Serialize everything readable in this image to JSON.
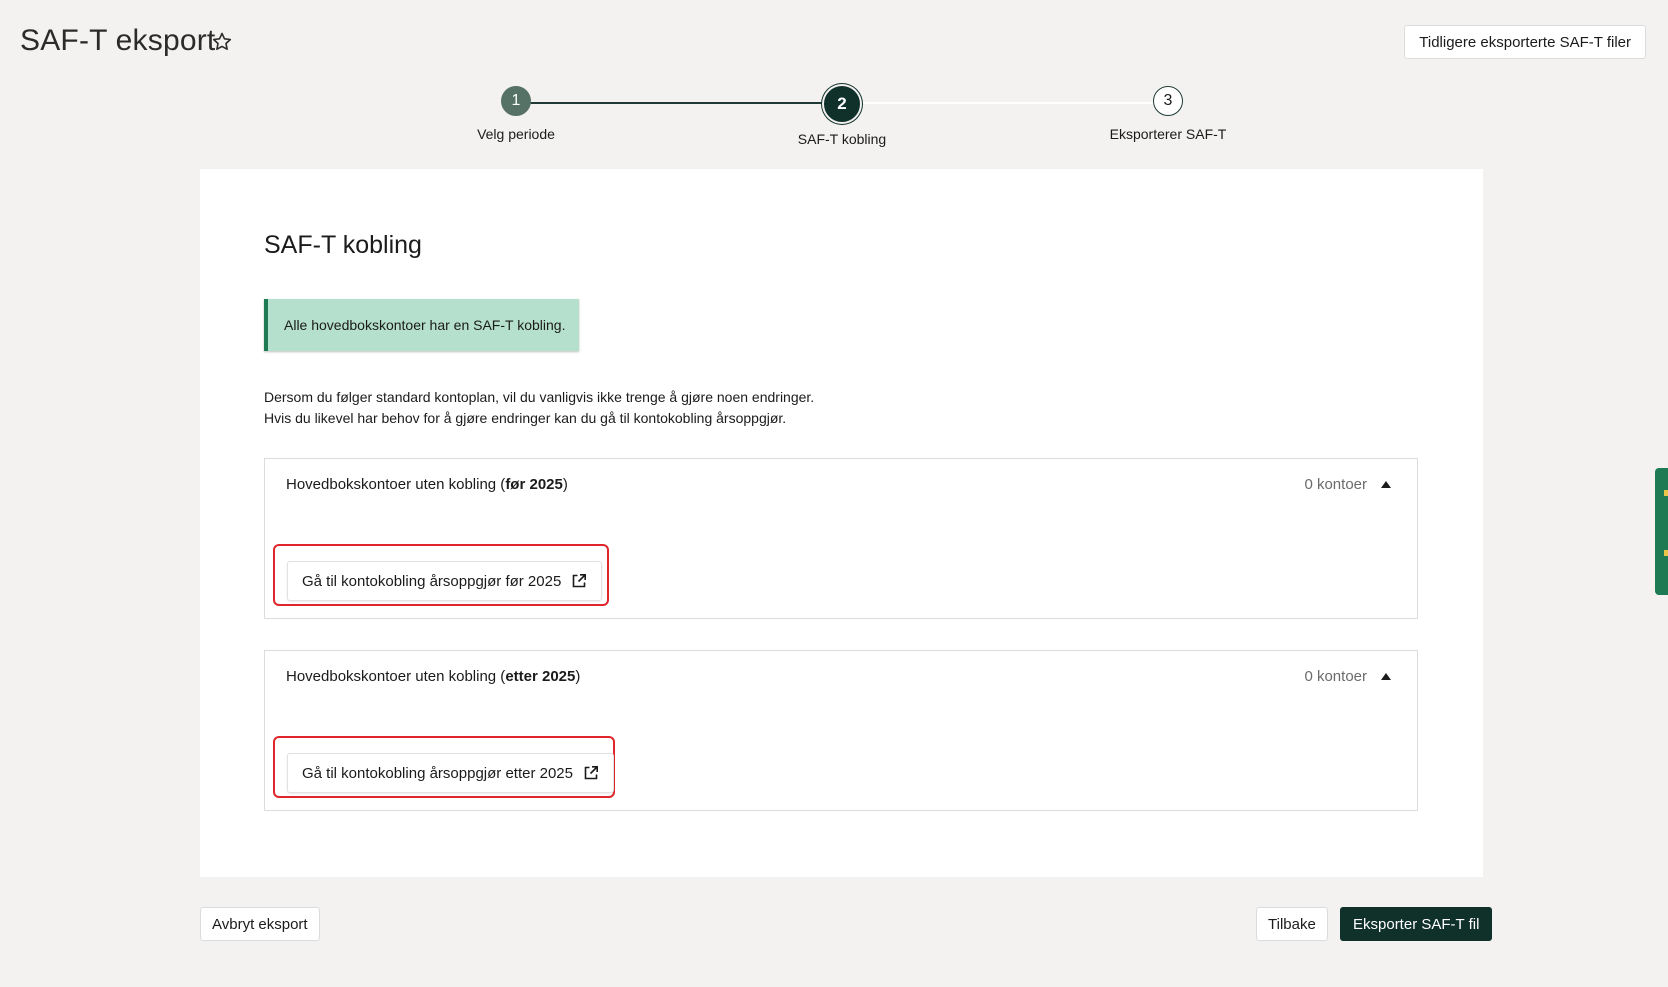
{
  "header": {
    "title": "SAF-T eksport",
    "favorite_icon": "star-outline-icon",
    "prev_files_label": "Tidligere eksporterte SAF-T filer"
  },
  "stepper": {
    "current_step": 2,
    "total_steps": 3,
    "steps": [
      {
        "number": "1",
        "label": "Velg periode",
        "state": "completed"
      },
      {
        "number": "2",
        "label": "SAF-T kobling",
        "state": "current"
      },
      {
        "number": "3",
        "label": "Eksporterer SAF-T",
        "state": "upcoming"
      }
    ]
  },
  "main": {
    "section_title": "SAF-T kobling",
    "alert_text": "Alle hovedbokskontoer har en SAF-T kobling.",
    "info_line_1": "Dersom du følger standard kontoplan, vil du vanligvis ikke trenge å gjøre noen endringer.",
    "info_line_2": "Hvis du likevel har behov for å gjøre endringer kan du gå til kontokobling årsoppgjør.",
    "accordions": [
      {
        "title_prefix": "Hovedbokskontoer uten kobling (",
        "title_bold": "før 2025",
        "title_suffix": ")",
        "count": "0 kontoer",
        "expanded": true,
        "button_label": "Gå til kontokobling årsoppgjør før 2025"
      },
      {
        "title_prefix": "Hovedbokskontoer uten kobling (",
        "title_bold": "etter 2025",
        "title_suffix": ")",
        "count": "0 kontoer",
        "expanded": true,
        "button_label": "Gå til kontokobling årsoppgjør etter 2025"
      }
    ]
  },
  "footer": {
    "cancel_label": "Avbryt eksport",
    "back_label": "Tilbake",
    "export_label": "Eksporter SAF-T fil"
  },
  "colors": {
    "background": "#f3f2f0",
    "primary": "#10302a",
    "success_bg": "#b5e0cd",
    "success_border": "#1e7a52",
    "highlight": "#e0262b"
  }
}
